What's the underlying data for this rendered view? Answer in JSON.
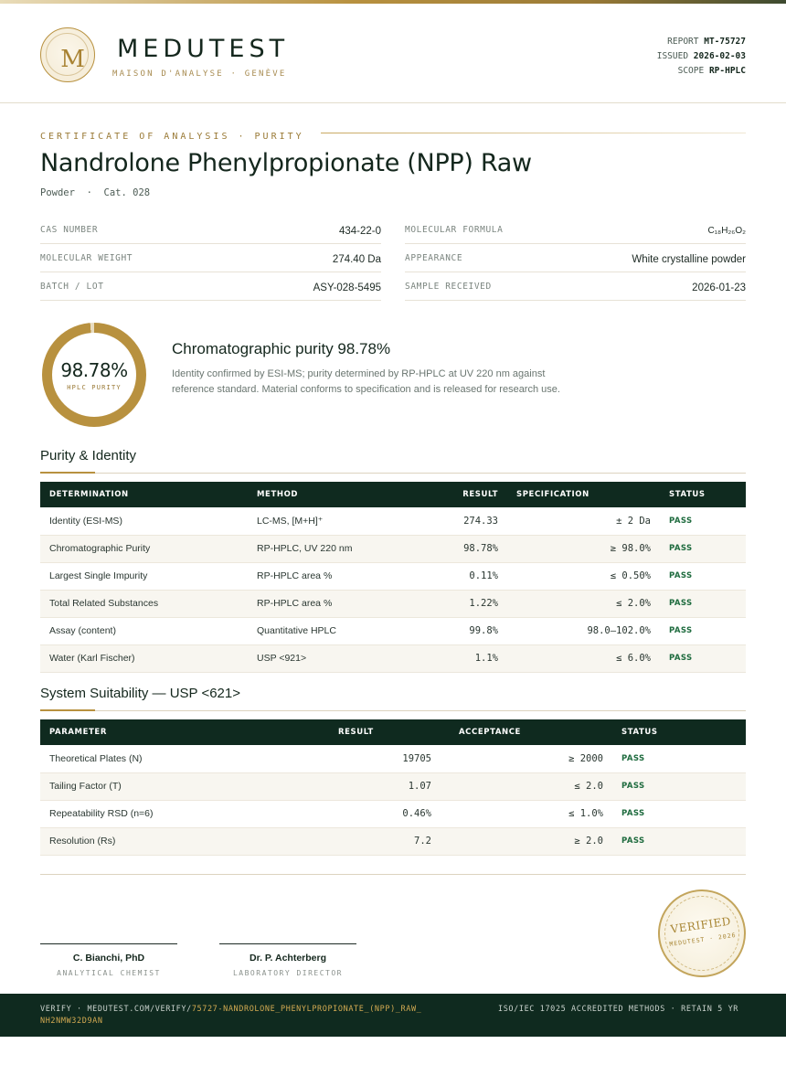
{
  "brand": {
    "logo_letter": "M",
    "name": "MEDUTEST",
    "tagline": "MAISON D'ANALYSE · GENÈVE"
  },
  "report": {
    "report_label": "REPORT",
    "report_value": "MT-75727",
    "issued_label": "ISSUED",
    "issued_value": "2026-02-03",
    "scope_label": "SCOPE",
    "scope_value": "RP-HPLC"
  },
  "certificate": {
    "kicker": "CERTIFICATE OF ANALYSIS · PURITY",
    "title": "Nandrolone Phenylpropionate (NPP) Raw",
    "subtitle": "Powder  ·  Cat. 028"
  },
  "properties": [
    {
      "label": "CAS NUMBER",
      "value": "434-22-0"
    },
    {
      "label": "MOLECULAR FORMULA",
      "value": "C₁₈H₂₆O₂"
    },
    {
      "label": "MOLECULAR WEIGHT",
      "value": "274.40 Da"
    },
    {
      "label": "APPEARANCE",
      "value": "White crystalline powder"
    },
    {
      "label": "BATCH / LOT",
      "value": "ASY-028-5495"
    },
    {
      "label": "SAMPLE RECEIVED",
      "value": "2026-01-23"
    }
  ],
  "purity": {
    "value": "98.78%",
    "fraction": 0.9878,
    "label": "HPLC PURITY",
    "heading": "Chromatographic purity 98.78%",
    "description": "Identity confirmed by ESI-MS; purity determined by RP-HPLC at UV 220 nm against reference standard. Material conforms to specification and is released for research use."
  },
  "identity_section": {
    "heading": "Purity & Identity",
    "columns": [
      "DETERMINATION",
      "METHOD",
      "RESULT",
      "SPECIFICATION",
      "STATUS"
    ],
    "rows": [
      {
        "determination": "Identity (ESI-MS)",
        "method": "LC-MS, [M+H]⁺",
        "result": "274.33",
        "spec": "± 2 Da",
        "status": "PASS"
      },
      {
        "determination": "Chromatographic Purity",
        "method": "RP-HPLC, UV 220 nm",
        "result": "98.78%",
        "spec": "≥ 98.0%",
        "status": "PASS"
      },
      {
        "determination": "Largest Single Impurity",
        "method": "RP-HPLC area %",
        "result": "0.11%",
        "spec": "≤ 0.50%",
        "status": "PASS"
      },
      {
        "determination": "Total Related Substances",
        "method": "RP-HPLC area %",
        "result": "1.22%",
        "spec": "≤ 2.0%",
        "status": "PASS"
      },
      {
        "determination": "Assay (content)",
        "method": "Quantitative HPLC",
        "result": "99.8%",
        "spec": "98.0–102.0%",
        "status": "PASS"
      },
      {
        "determination": "Water (Karl Fischer)",
        "method": "USP <921>",
        "result": "1.1%",
        "spec": "≤ 6.0%",
        "status": "PASS"
      }
    ]
  },
  "suitability_section": {
    "heading": "System Suitability — USP <621>",
    "columns": [
      "PARAMETER",
      "RESULT",
      "ACCEPTANCE",
      "STATUS"
    ],
    "rows": [
      {
        "parameter": "Theoretical Plates (N)",
        "result": "19705",
        "acceptance": "≥ 2000",
        "status": "PASS"
      },
      {
        "parameter": "Tailing Factor (T)",
        "result": "1.07",
        "acceptance": "≤ 2.0",
        "status": "PASS"
      },
      {
        "parameter": "Repeatability RSD (n=6)",
        "result": "0.46%",
        "acceptance": "≤ 1.0%",
        "status": "PASS"
      },
      {
        "parameter": "Resolution (Rs)",
        "result": "7.2",
        "acceptance": "≥ 2.0",
        "status": "PASS"
      }
    ]
  },
  "signatures": [
    {
      "name": "C. Bianchi, PhD",
      "role": "ANALYTICAL CHEMIST"
    },
    {
      "name": "Dr. P. Achterberg",
      "role": "LABORATORY DIRECTOR"
    }
  ],
  "stamp": {
    "main": "VERIFIED",
    "sub": "MEDUTEST · 2026"
  },
  "footer": {
    "verify_prefix": "VERIFY · MEDUTEST.COM/VERIFY/",
    "verify_code": "75727-NANDROLONE_PHENYLPROPIONATE_(NPP)_RAW_NH2NMW32D9AN",
    "accreditation": "ISO/IEC 17025 ACCREDITED METHODS · RETAIN 5 YR"
  },
  "colors": {
    "dark_green": "#0f2a1f",
    "gold": "#b8913f",
    "pass_green": "#1e6b3e"
  }
}
